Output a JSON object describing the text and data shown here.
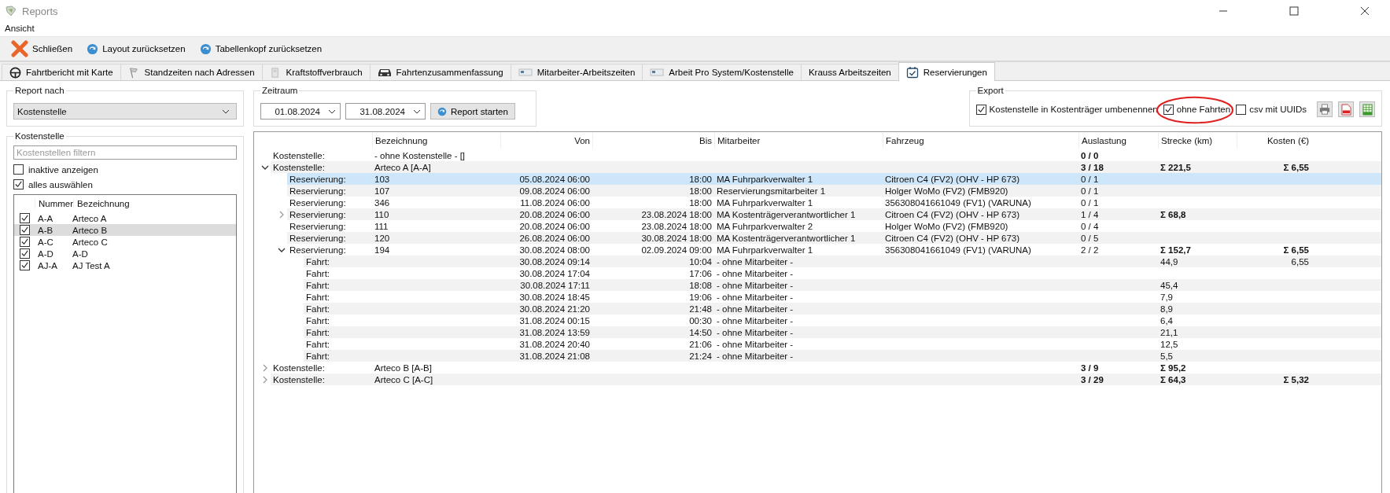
{
  "window": {
    "title": "Reports"
  },
  "menu": [
    "Ansicht"
  ],
  "toolbar": [
    {
      "kind": "close",
      "label": "Schließen"
    },
    {
      "kind": "reset",
      "label": "Layout zurücksetzen"
    },
    {
      "kind": "reset",
      "label": "Tabellenkopf zurücksetzen"
    }
  ],
  "tabs": [
    {
      "label": "Fahrtbericht mit Karte",
      "selected": false
    },
    {
      "label": "Standzeiten nach Adressen",
      "selected": false
    },
    {
      "label": "Kraftstoffverbrauch",
      "selected": false
    },
    {
      "label": "Fahrtenzusammenfassung",
      "selected": false
    },
    {
      "label": "Mitarbeiter-Arbeitszeiten",
      "selected": false
    },
    {
      "label": "Arbeit Pro System/Kostenstelle",
      "selected": false
    },
    {
      "label": "Krauss Arbeitszeiten",
      "selected": false
    },
    {
      "label": "Reservierungen",
      "selected": true
    }
  ],
  "report_nach": {
    "title": "Report nach",
    "value": "Kostenstelle"
  },
  "zeitraum": {
    "title": "Zeitraum",
    "from": "01.08.2024",
    "to": "31.08.2024",
    "button": "Report starten"
  },
  "export": {
    "title": "Export",
    "options": [
      {
        "label": "Kostenstelle in Kostenträger umbenennen",
        "checked": true,
        "circled": false
      },
      {
        "label": "ohne Fahrten",
        "checked": true,
        "circled": true
      },
      {
        "label": "csv mit UUIDs",
        "checked": false,
        "circled": false
      }
    ]
  },
  "kostenstelle_panel": {
    "title": "Kostenstelle",
    "filter_placeholder": "Kostenstellen filtern",
    "options": [
      {
        "label": "inaktive anzeigen",
        "checked": false
      },
      {
        "label": "alles auswählen",
        "checked": true
      }
    ],
    "columns": [
      "Nummer",
      "Bezeichnung"
    ],
    "rows": [
      {
        "nummer": "A-A",
        "bezeichnung": "Arteco A",
        "checked": true,
        "selected": false
      },
      {
        "nummer": "A-B",
        "bezeichnung": "Arteco B",
        "checked": true,
        "selected": true
      },
      {
        "nummer": "A-C",
        "bezeichnung": "Arteco C",
        "checked": true,
        "selected": false
      },
      {
        "nummer": "A-D",
        "bezeichnung": "A-D",
        "checked": true,
        "selected": false
      },
      {
        "nummer": "AJ-A",
        "bezeichnung": "AJ Test A",
        "checked": true,
        "selected": false
      }
    ]
  },
  "table": {
    "columns": [
      "Bezeichnung",
      "Von",
      "Bis",
      "Mitarbeiter",
      "Fahrzeug",
      "Auslastung",
      "Strecke (km)",
      "Kosten (€)"
    ],
    "rows": [
      {
        "kind": "kostenstelle",
        "label": "Kostenstelle:",
        "bezeichnung": "- ohne Kostenstelle - []",
        "auslastung": "0 / 0",
        "selected": false
      },
      {
        "kind": "kostenstelle",
        "label": "Kostenstelle:",
        "bezeichnung": "Arteco A [A-A]",
        "auslastung": "3 / 18",
        "strecke": "Σ 221,5",
        "kosten": "Σ 6,55",
        "selected": false,
        "expanded": true,
        "children": [
          {
            "kind": "reservierung",
            "label": "Reservierung:",
            "bezeichnung": "103",
            "von": "05.08.2024 06:00",
            "bis": "18:00",
            "mitarbeiter": "MA Fuhrparkverwalter 1",
            "fahrzeug": "Citroen C4 (FV2) (OHV - HP 673)",
            "auslastung": "0 / 1",
            "selected": true
          },
          {
            "kind": "reservierung",
            "label": "Reservierung:",
            "bezeichnung": "107",
            "von": "09.08.2024 06:00",
            "bis": "18:00",
            "mitarbeiter": "Reservierungsmitarbeiter 1",
            "fahrzeug": "Holger WoMo (FV2) (FMB920)",
            "auslastung": "0 / 1",
            "selected": false
          },
          {
            "kind": "reservierung",
            "label": "Reservierung:",
            "bezeichnung": "346",
            "von": "11.08.2024 06:00",
            "bis": "18:00",
            "mitarbeiter": "MA Fuhrparkverwalter 1",
            "fahrzeug": "356308041661049 (FV1) (VARUNA)",
            "auslastung": "0 / 1",
            "selected": false
          },
          {
            "kind": "reservierung",
            "label": "Reservierung:",
            "bezeichnung": "110",
            "von": "20.08.2024 06:00",
            "bis": "23.08.2024 18:00",
            "mitarbeiter": "MA Kostenträgerverantwortlicher 1",
            "fahrzeug": "Citroen C4 (FV2) (OHV - HP 673)",
            "auslastung": "1 / 4",
            "strecke": "Σ 68,8",
            "selected": false,
            "expanded": false
          },
          {
            "kind": "reservierung",
            "label": "Reservierung:",
            "bezeichnung": "111",
            "von": "20.08.2024 06:00",
            "bis": "23.08.2024 18:00",
            "mitarbeiter": "MA Fuhrparkverwalter 2",
            "fahrzeug": "Holger WoMo (FV2) (FMB920)",
            "auslastung": "0 / 4",
            "selected": false
          },
          {
            "kind": "reservierung",
            "label": "Reservierung:",
            "bezeichnung": "120",
            "von": "26.08.2024 06:00",
            "bis": "30.08.2024 18:00",
            "mitarbeiter": "MA Kostenträgerverantwortlicher 1",
            "fahrzeug": "Citroen C4 (FV2) (OHV - HP 673)",
            "auslastung": "0 / 5",
            "selected": false
          },
          {
            "kind": "reservierung",
            "label": "Reservierung:",
            "bezeichnung": "194",
            "von": "30.08.2024 08:00",
            "bis": "02.09.2024 09:00",
            "mitarbeiter": "MA Fuhrparkverwalter 1",
            "fahrzeug": "356308041661049 (FV1) (VARUNA)",
            "auslastung": "2 / 2",
            "strecke": "Σ 152,7",
            "kosten": "Σ 6,55",
            "selected": false,
            "expanded": true,
            "children": [
              {
                "kind": "fahrt",
                "label": "Fahrt:",
                "von": "30.08.2024 09:14",
                "bis": "10:04",
                "mitarbeiter": "- ohne Mitarbeiter -",
                "strecke": "44,9",
                "kosten": "6,55",
                "selected": false
              },
              {
                "kind": "fahrt",
                "label": "Fahrt:",
                "von": "30.08.2024 17:04",
                "bis": "17:06",
                "mitarbeiter": "- ohne Mitarbeiter -",
                "selected": false
              },
              {
                "kind": "fahrt",
                "label": "Fahrt:",
                "von": "30.08.2024 17:11",
                "bis": "18:08",
                "mitarbeiter": "- ohne Mitarbeiter -",
                "strecke": "45,4",
                "selected": false
              },
              {
                "kind": "fahrt",
                "label": "Fahrt:",
                "von": "30.08.2024 18:45",
                "bis": "19:06",
                "mitarbeiter": "- ohne Mitarbeiter -",
                "strecke": "7,9",
                "selected": false
              },
              {
                "kind": "fahrt",
                "label": "Fahrt:",
                "von": "30.08.2024 21:20",
                "bis": "21:48",
                "mitarbeiter": "- ohne Mitarbeiter -",
                "strecke": "8,9",
                "selected": false
              },
              {
                "kind": "fahrt",
                "label": "Fahrt:",
                "von": "31.08.2024 00:15",
                "bis": "00:30",
                "mitarbeiter": "- ohne Mitarbeiter -",
                "strecke": "6,4",
                "selected": false
              },
              {
                "kind": "fahrt",
                "label": "Fahrt:",
                "von": "31.08.2024 13:59",
                "bis": "14:50",
                "mitarbeiter": "- ohne Mitarbeiter -",
                "strecke": "21,1",
                "selected": false
              },
              {
                "kind": "fahrt",
                "label": "Fahrt:",
                "von": "31.08.2024 20:40",
                "bis": "21:06",
                "mitarbeiter": "- ohne Mitarbeiter -",
                "strecke": "12,5",
                "selected": false
              },
              {
                "kind": "fahrt",
                "label": "Fahrt:",
                "von": "31.08.2024 21:08",
                "bis": "21:24",
                "mitarbeiter": "- ohne Mitarbeiter -",
                "strecke": "5,5",
                "selected": false
              }
            ]
          }
        ]
      },
      {
        "kind": "kostenstelle",
        "label": "Kostenstelle:",
        "bezeichnung": "Arteco B [A-B]",
        "auslastung": "3 / 9",
        "strecke": "Σ 95,2",
        "selected": false,
        "expanded": false
      },
      {
        "kind": "kostenstelle",
        "label": "Kostenstelle:",
        "bezeichnung": "Arteco C [A-C]",
        "auslastung": "3 / 29",
        "strecke": "Σ 64,3",
        "kosten": "Σ 5,32",
        "selected": false,
        "expanded": false
      }
    ]
  }
}
